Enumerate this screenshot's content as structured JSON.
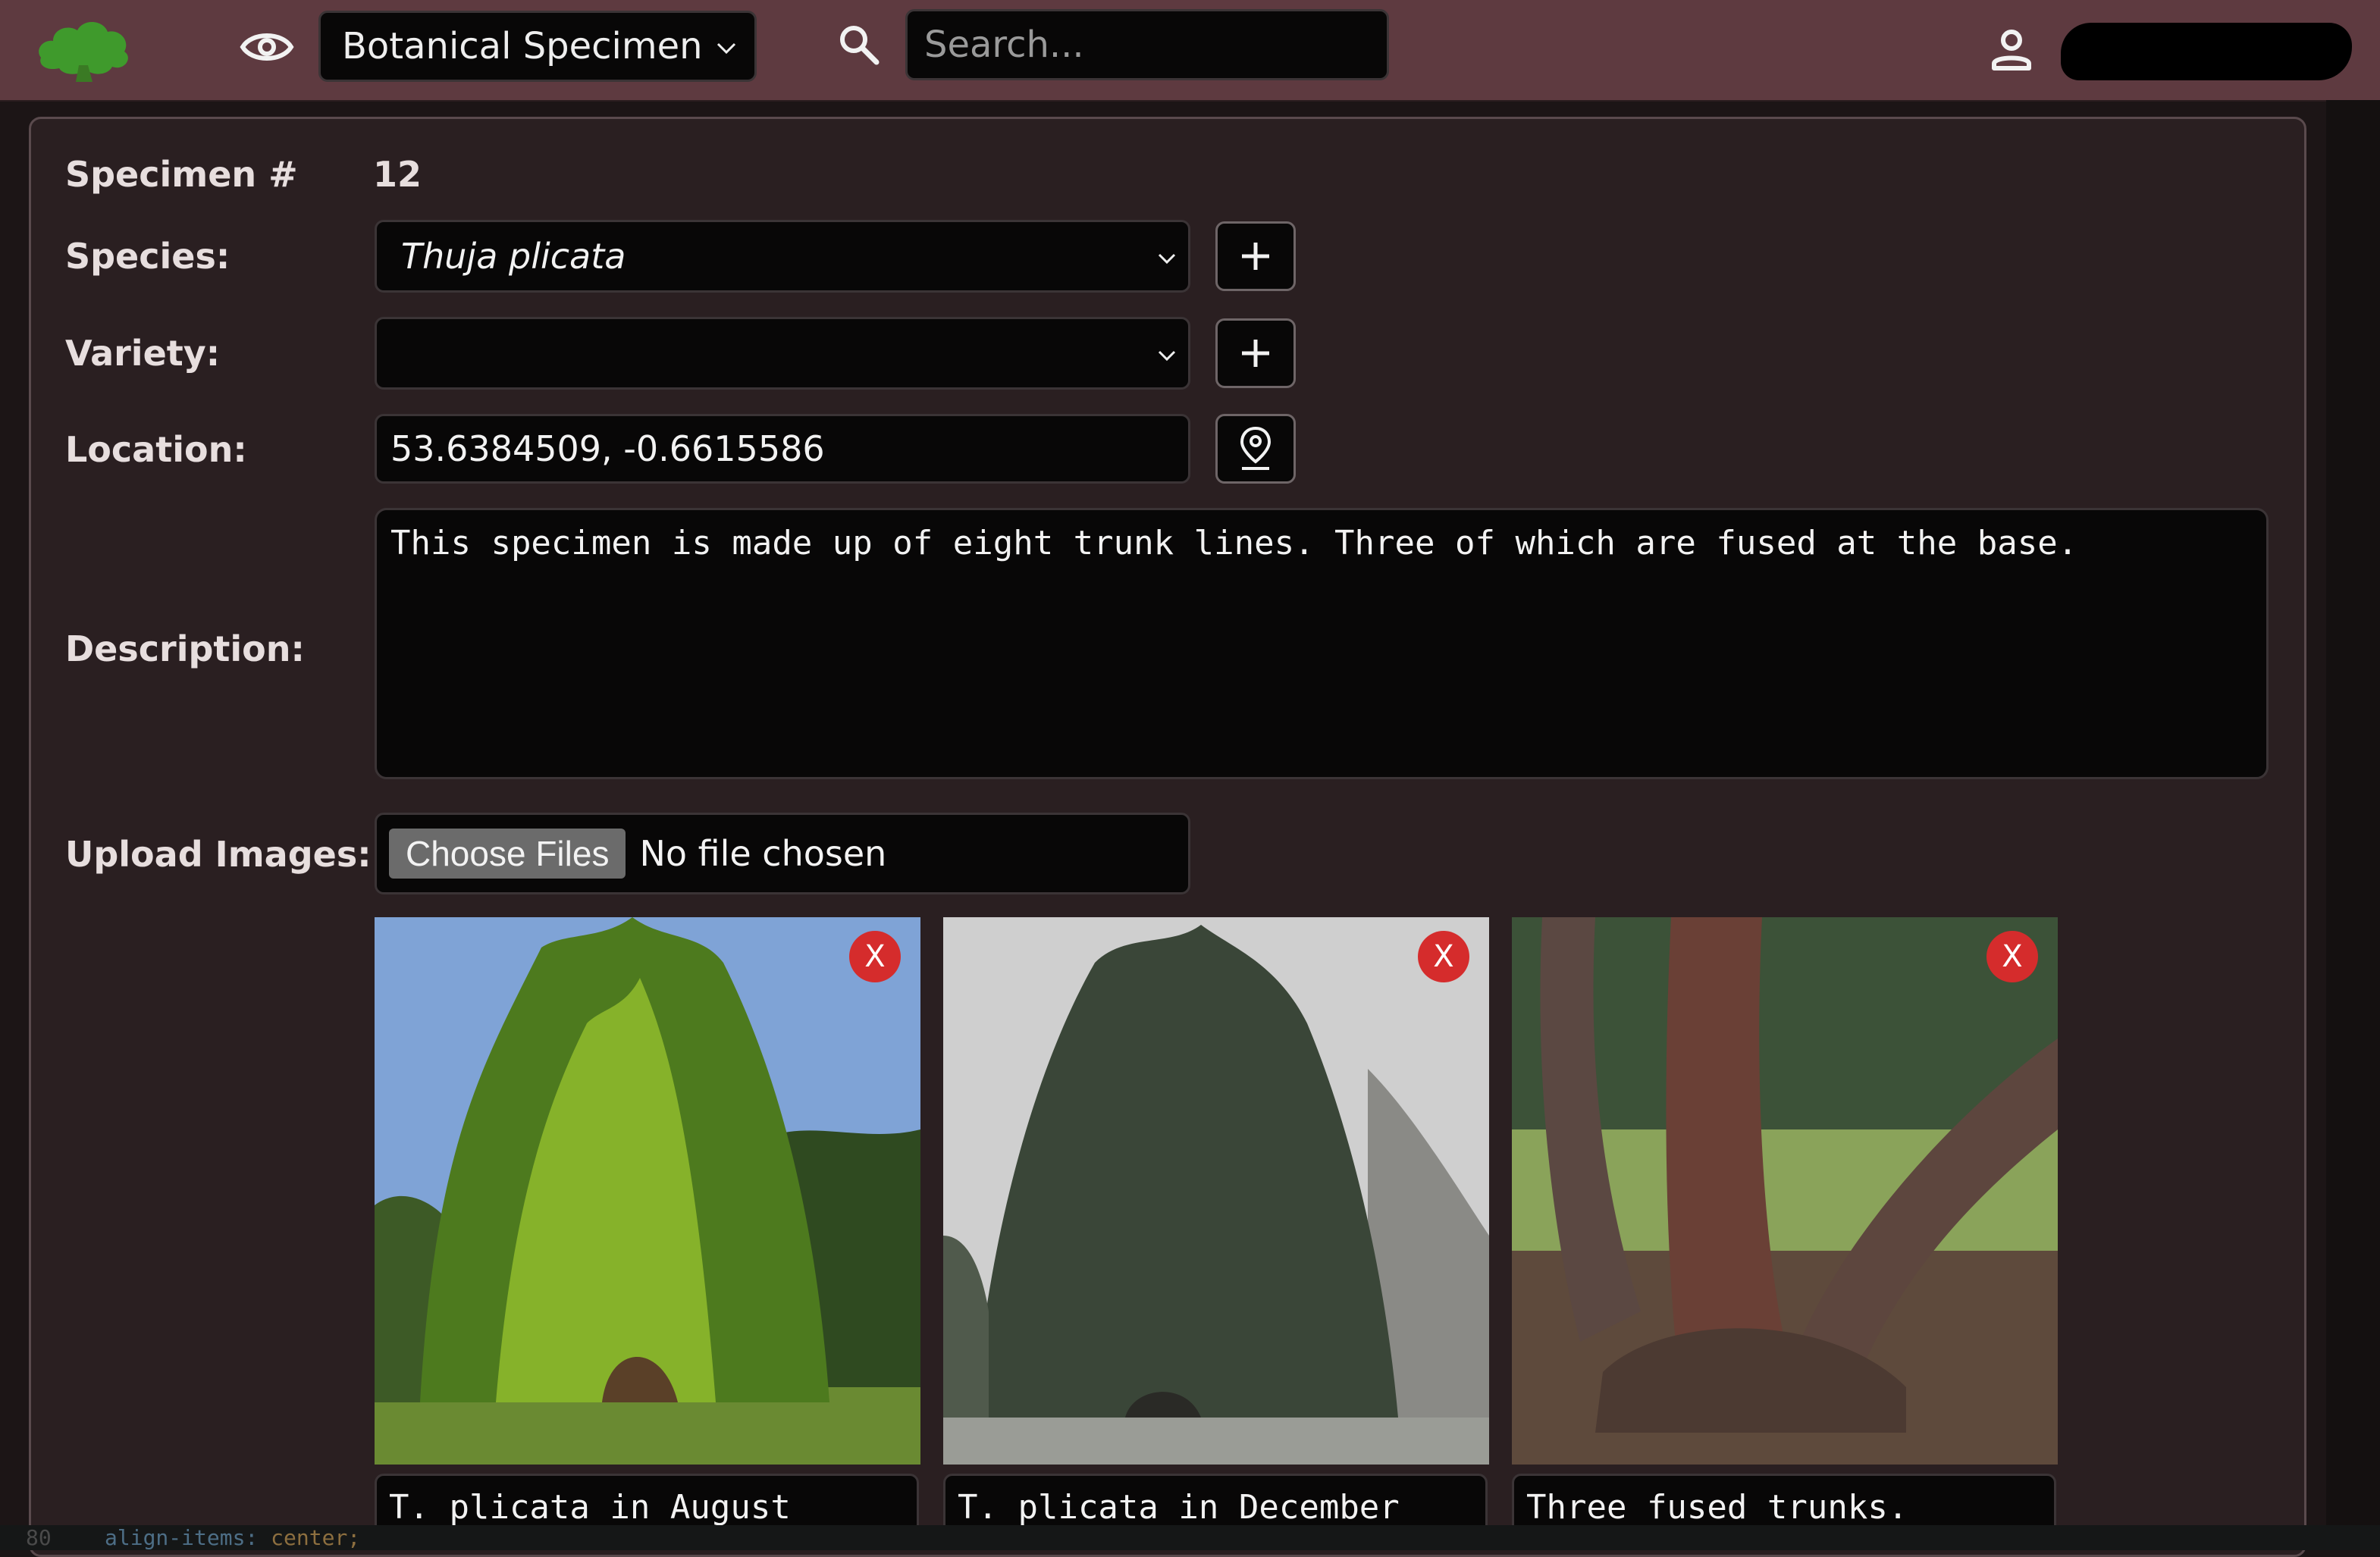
{
  "header": {
    "view_mode": "Botanical Specimen",
    "search_placeholder": "Search..."
  },
  "form": {
    "specimen_label": "Specimen #",
    "specimen_number": "12",
    "species_label": "Species:",
    "species_value": "Thuja plicata",
    "variety_label": "Variety:",
    "variety_value": "",
    "location_label": "Location:",
    "location_value": "53.6384509, -0.6615586",
    "description_label": "Description:",
    "description_value": "This specimen is made up of eight trunk lines. Three of which are fused at the base.",
    "upload_label": "Upload Images:",
    "choose_files_label": "Choose Files",
    "no_file_text": "No file chosen"
  },
  "images": [
    {
      "caption": "T. plicata in August",
      "delete_label": "X"
    },
    {
      "caption": "T. plicata in December",
      "delete_label": "X"
    },
    {
      "caption": "Three fused trunks.",
      "delete_label": "X"
    }
  ],
  "code_strip": {
    "line_number": "80",
    "property": "align-items:",
    "value": "center;"
  },
  "colors": {
    "header_bg": "#5e3a40",
    "panel_bg": "#2a1f21",
    "field_bg": "#080707",
    "delete_red": "#d52c2c",
    "logo_green": "#3f9a2c"
  },
  "icons": [
    "tree-logo-icon",
    "eye-icon",
    "chevron-down-icon",
    "search-icon",
    "user-icon",
    "plus-icon",
    "map-pin-icon"
  ]
}
